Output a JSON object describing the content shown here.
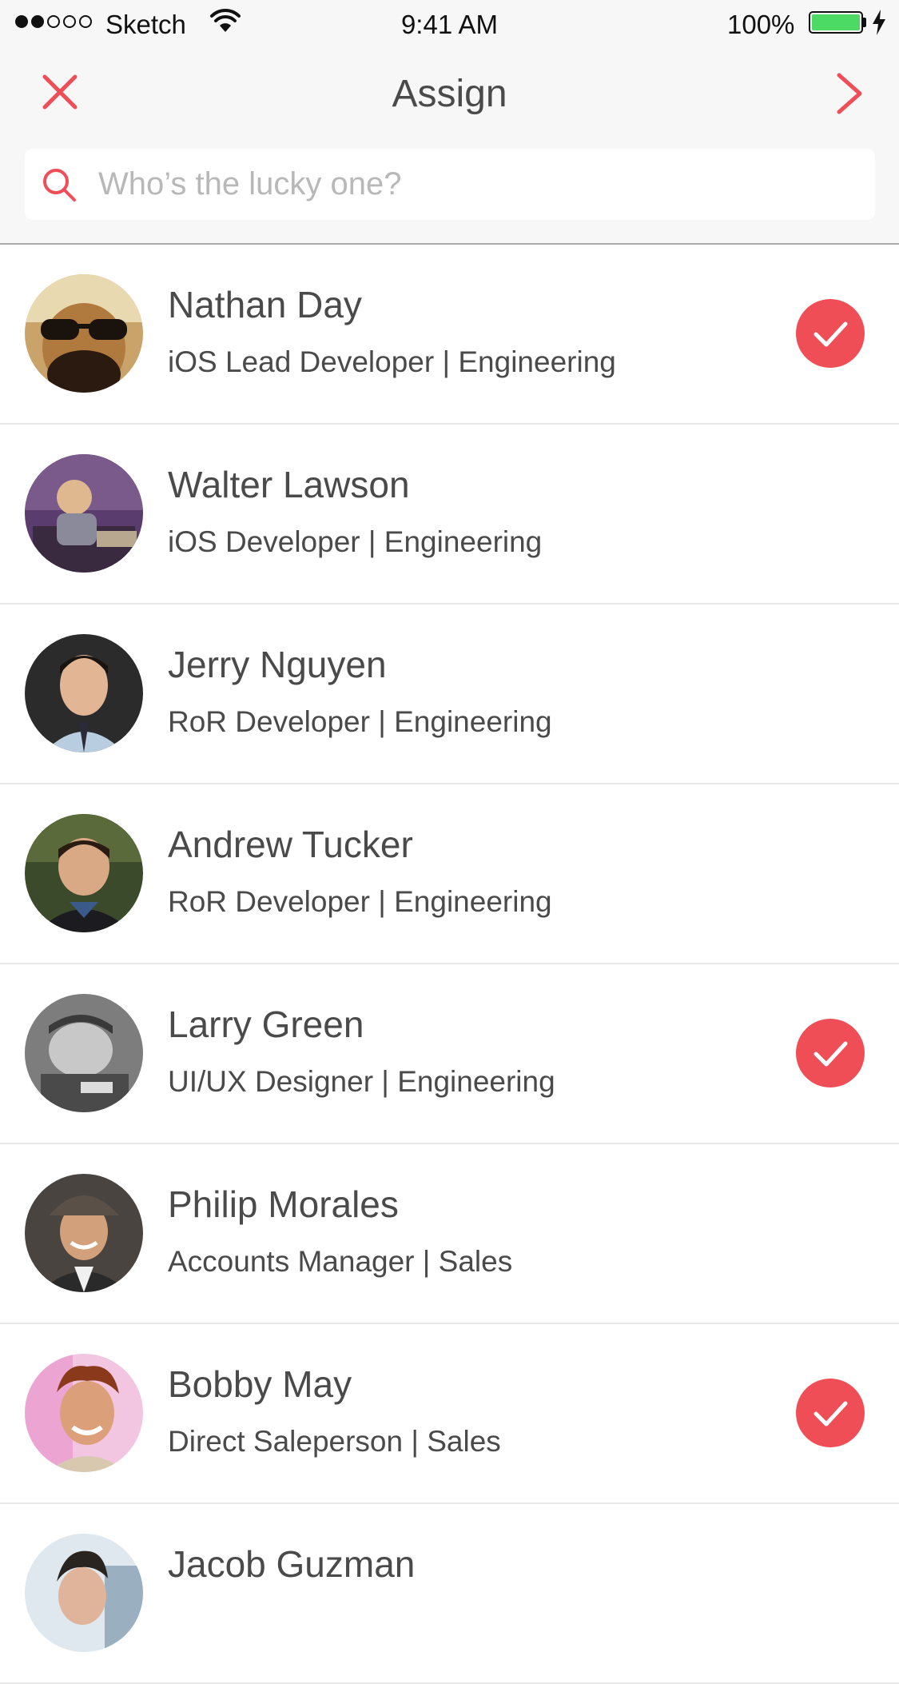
{
  "status_bar": {
    "carrier": "Sketch",
    "time": "9:41 AM",
    "battery": "100%",
    "signal_bars": 2,
    "signal_total": 5
  },
  "nav": {
    "title": "Assign",
    "close_icon": "close-icon",
    "next_icon": "chevron-right-icon"
  },
  "search": {
    "placeholder": "Who’s the lucky one?",
    "value": "",
    "icon": "search-icon"
  },
  "colors": {
    "accent": "#f04e57",
    "text": "#4a4a4a",
    "placeholder": "#b8b8b8",
    "header_bg": "#f7f7f7",
    "battery": "#4cd964"
  },
  "people": [
    {
      "name": "Nathan Day",
      "role": "iOS Lead Developer | Engineering",
      "selected": true
    },
    {
      "name": "Walter Lawson",
      "role": "iOS Developer | Engineering",
      "selected": false
    },
    {
      "name": "Jerry Nguyen",
      "role": "RoR Developer | Engineering",
      "selected": false
    },
    {
      "name": "Andrew Tucker",
      "role": "RoR Developer | Engineering",
      "selected": false
    },
    {
      "name": "Larry Green",
      "role": "UI/UX Designer | Engineering",
      "selected": true
    },
    {
      "name": "Philip Morales",
      "role": "Accounts Manager | Sales",
      "selected": false
    },
    {
      "name": "Bobby May",
      "role": "Direct Saleperson | Sales",
      "selected": true
    },
    {
      "name": "Jacob Guzman",
      "role": "",
      "selected": false
    }
  ]
}
